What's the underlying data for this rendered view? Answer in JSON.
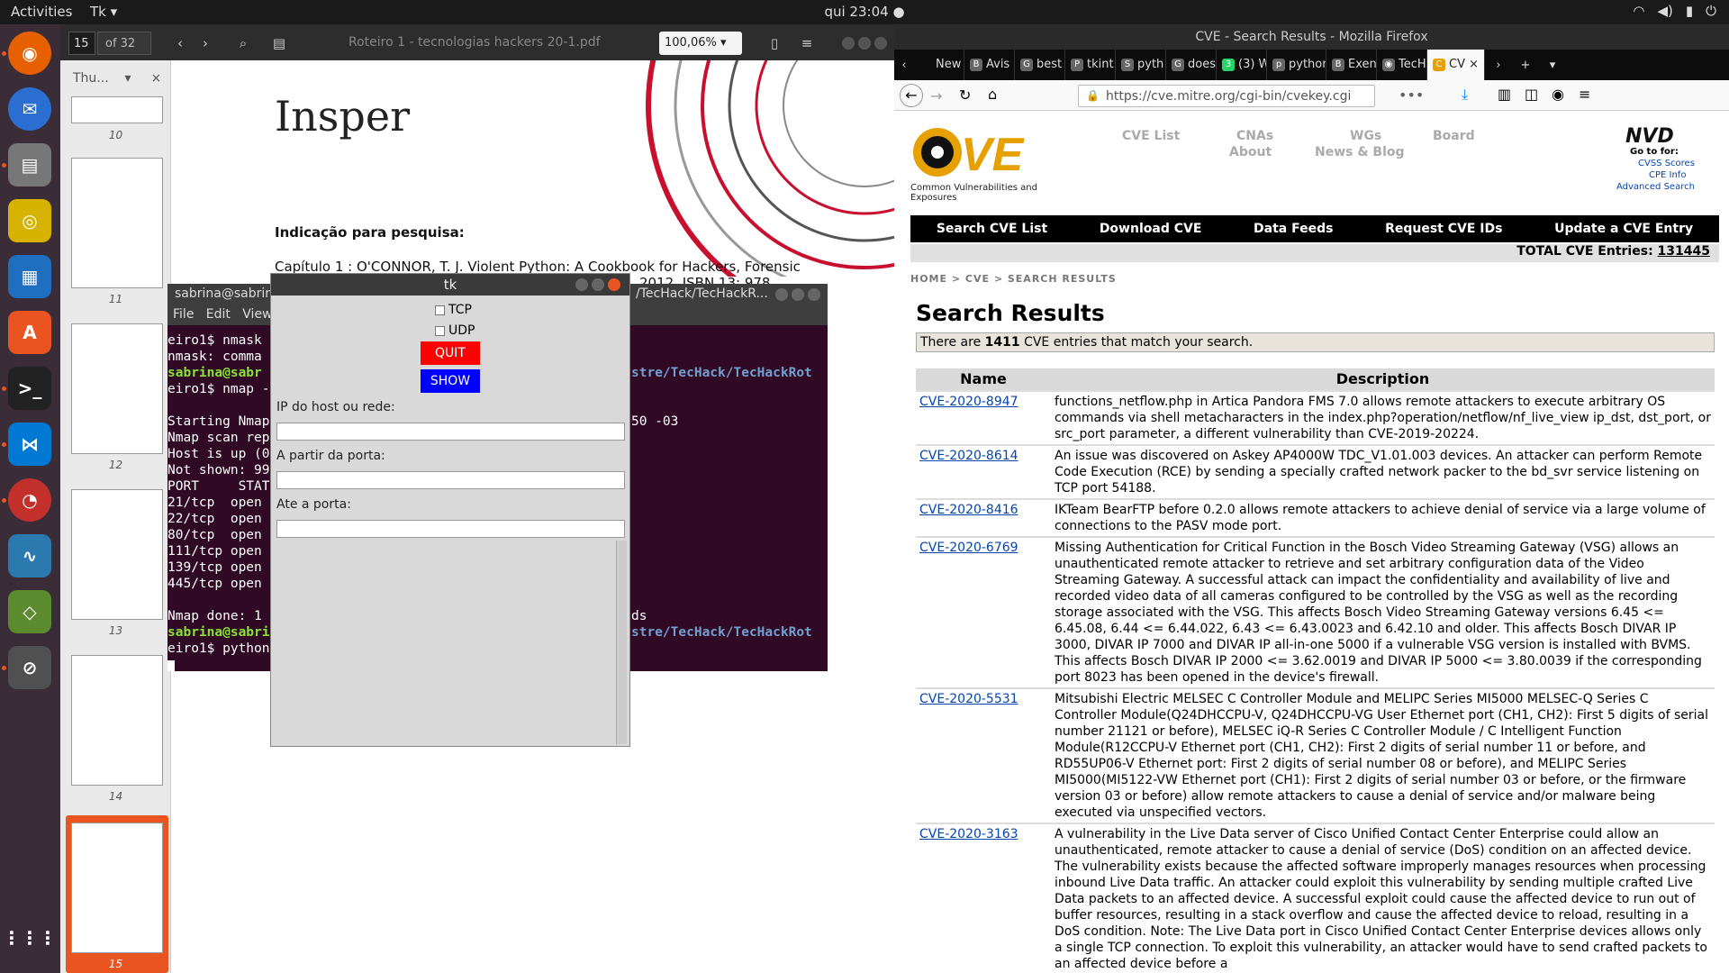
{
  "topbar": {
    "activities": "Activities",
    "app": "Tk",
    "clock": "qui 23:04"
  },
  "dock": {
    "items": [
      "Firefox",
      "Thunderbird",
      "Files",
      "Rhythmbox",
      "LibreOffice Writer",
      "Ubuntu Software",
      "Terminal",
      "VS Code",
      "Document Viewer",
      "System Monitor",
      "Dia",
      "Disk"
    ]
  },
  "evince": {
    "page_current": "15",
    "page_of": "of 32",
    "title": "Roteiro 1 - tecnologias hackers 20-1.pdf",
    "zoom": "100,06%",
    "sidebar_label": "Thu...",
    "thumb_pages": [
      "10",
      "11",
      "12",
      "13",
      "14",
      "15"
    ],
    "doc": {
      "logo": "Insper",
      "heading": "Indicação para pesquisa:",
      "line1": "Capítulo 1 : O'CONNOR, T. J. Violent Python: A Cookbook for Hackers, Forensic",
      "line2": "2012. ISBN 13: 978"
    }
  },
  "terminal": {
    "title": "sabrina@sabrin",
    "path_title": "/TecHack/TecHackR...",
    "menu": [
      "File",
      "Edit",
      "View"
    ],
    "lines_left": [
      "eiro1$ nmask",
      "nmask: comma",
      "sabrina@sabr",
      "eiro1$ nmap -",
      "",
      "Starting Nmap",
      "Nmap scan rep",
      "Host is up (0",
      "Not shown: 99",
      "PORT     STATE",
      "21/tcp  open",
      "22/tcp  open",
      "80/tcp  open",
      "111/tcp open",
      "139/tcp open",
      "445/tcp open",
      "",
      "Nmap done: 1",
      "sabrina@sabri",
      "eiro1$ python"
    ],
    "right_path": "stre/TecHack/TecHackRot",
    "right_args": "50 -03",
    "right_ds": "ds",
    "right_path2": "stre/TecHack/TecHackRot"
  },
  "tk": {
    "title": "tk",
    "tcp": "TCP",
    "udp": "UDP",
    "quit": "QUIT",
    "show": "SHOW",
    "ip_label": "IP do host ou rede:",
    "from_label": "A partir da porta:",
    "to_label": "Ate a porta:"
  },
  "firefox": {
    "window_title": "CVE - Search Results - Mozilla Firefox",
    "tabs": [
      "New",
      "Avis",
      "best",
      "tkint",
      "pyth",
      "does",
      "(3) W",
      "python-",
      "Exen",
      "TecH",
      "CV"
    ],
    "url": "https://cve.mitre.org/cgi-bin/cvekey.cgi",
    "cve": {
      "logo_sub": "Common Vulnerabilities and Exposures",
      "nav": [
        "CVE List",
        "CNAs",
        "WGs",
        "Board",
        "About",
        "News & Blog"
      ],
      "nvd": "NVD",
      "goto": "Go to for:",
      "nvd_links": [
        "CVSS Scores",
        "CPE Info",
        "Advanced Search"
      ],
      "bar": [
        "Search CVE List",
        "Download CVE",
        "Data Feeds",
        "Request CVE IDs",
        "Update a CVE Entry"
      ],
      "total_label": "TOTAL CVE Entries:",
      "total": "131445",
      "breadcrumb": "HOME > CVE > SEARCH RESULTS",
      "heading": "Search Results",
      "count_pre": "There are",
      "count": "1411",
      "count_post": "CVE entries that match your search.",
      "col_name": "Name",
      "col_desc": "Description",
      "rows": [
        {
          "id": "CVE-2020-8947",
          "desc": "functions_netflow.php in Artica Pandora FMS 7.0 allows remote attackers to execute arbitrary OS commands via shell metacharacters in the index.php?operation/netflow/nf_live_view ip_dst, dst_port, or src_port parameter, a different vulnerability than CVE-2019-20224."
        },
        {
          "id": "CVE-2020-8614",
          "desc": "An issue was discovered on Askey AP4000W TDC_V1.01.003 devices. An attacker can perform Remote Code Execution (RCE) by sending a specially crafted network packer to the bd_svr service listening on TCP port 54188."
        },
        {
          "id": "CVE-2020-8416",
          "desc": "IKTeam BearFTP before 0.2.0 allows remote attackers to achieve denial of service via a large volume of connections to the PASV mode port."
        },
        {
          "id": "CVE-2020-6769",
          "desc": "Missing Authentication for Critical Function in the Bosch Video Streaming Gateway (VSG) allows an unauthenticated remote attacker to retrieve and set arbitrary configuration data of the Video Streaming Gateway. A successful attack can impact the confidentiality and availability of live and recorded video data of all cameras configured to be controlled by the VSG as well as the recording storage associated with the VSG. This affects Bosch Video Streaming Gateway versions 6.45 <= 6.45.08, 6.44 <= 6.44.022, 6.43 <= 6.43.0023 and 6.42.10 and older. This affects Bosch DIVAR IP 3000, DIVAR IP 7000 and DIVAR IP all-in-one 5000 if a vulnerable VSG version is installed with BVMS. This affects Bosch DIVAR IP 2000 <= 3.62.0019 and DIVAR IP 5000 <= 3.80.0039 if the corresponding port 8023 has been opened in the device's firewall."
        },
        {
          "id": "CVE-2020-5531",
          "desc": "Mitsubishi Electric MELSEC C Controller Module and MELIPC Series MI5000 MELSEC-Q Series C Controller Module(Q24DHCCPU-V, Q24DHCCPU-VG User Ethernet port (CH1, CH2): First 5 digits of serial number 21121 or before), MELSEC iQ-R Series C Controller Module / C Intelligent Function Module(R12CCPU-V Ethernet port (CH1, CH2): First 2 digits of serial number 11 or before, and RD55UP06-V Ethernet port: First 2 digits of serial number 08 or before), and MELIPC Series MI5000(MI5122-VW Ethernet port (CH1): First 2 digits of serial number 03 or before, or the firmware version 03 or before) allow remote attackers to cause a denial of service and/or malware being executed via unspecified vectors."
        },
        {
          "id": "CVE-2020-3163",
          "desc": "A vulnerability in the Live Data server of Cisco Unified Contact Center Enterprise could allow an unauthenticated, remote attacker to cause a denial of service (DoS) condition on an affected device. The vulnerability exists because the affected software improperly manages resources when processing inbound Live Data traffic. An attacker could exploit this vulnerability by sending multiple crafted Live Data packets to an affected device. A successful exploit could cause the affected device to run out of buffer resources, resulting in a stack overflow and cause the affected device to reload, resulting in a DoS condition. Note: The Live Data port in Cisco Unified Contact Center Enterprise devices allows only a single TCP connection. To exploit this vulnerability, an attacker would have to send crafted packets to an affected device before a"
        }
      ]
    }
  }
}
